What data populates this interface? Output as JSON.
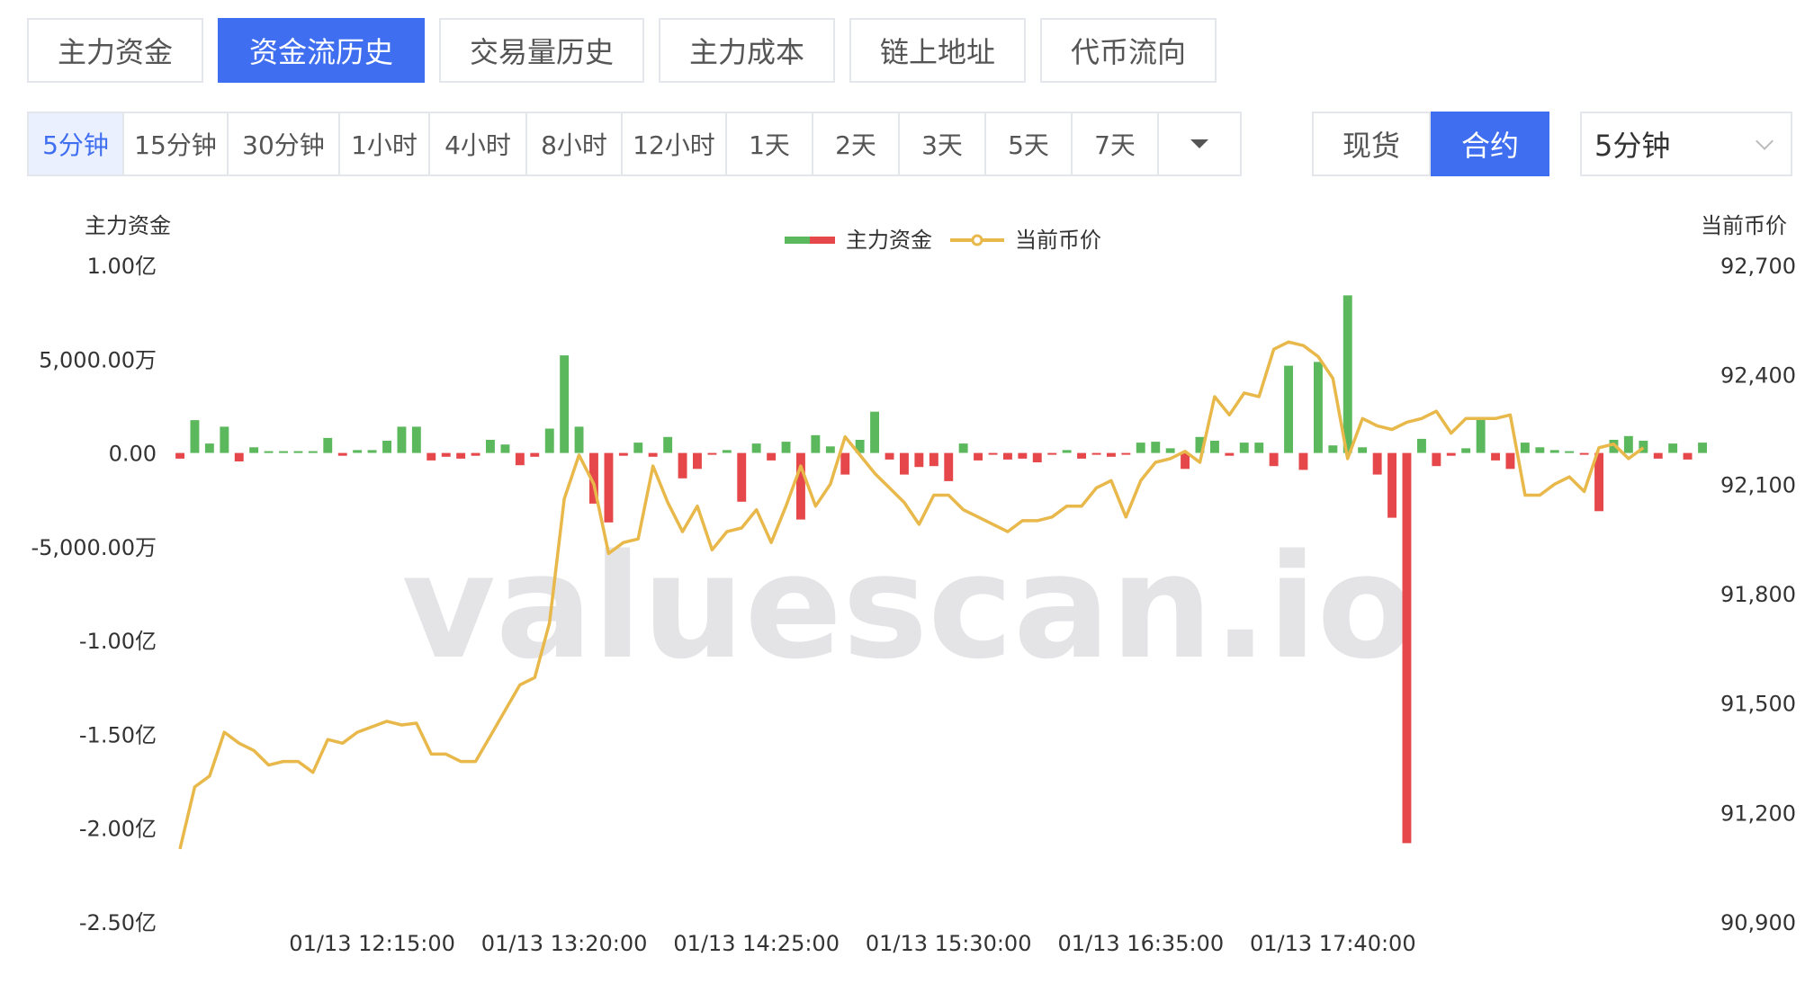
{
  "tabs": [
    {
      "label": "主力资金",
      "active": false
    },
    {
      "label": "资金流历史",
      "active": true
    },
    {
      "label": "交易量历史",
      "active": false
    },
    {
      "label": "主力成本",
      "active": false
    },
    {
      "label": "链上地址",
      "active": false
    },
    {
      "label": "代币流向",
      "active": false
    }
  ],
  "intervals": [
    {
      "label": "5分钟",
      "active": true
    },
    {
      "label": "15分钟",
      "active": false
    },
    {
      "label": "30分钟",
      "active": false
    },
    {
      "label": "1小时",
      "active": false
    },
    {
      "label": "4小时",
      "active": false
    },
    {
      "label": "8小时",
      "active": false
    },
    {
      "label": "12小时",
      "active": false
    },
    {
      "label": "1天",
      "active": false
    },
    {
      "label": "2天",
      "active": false
    },
    {
      "label": "3天",
      "active": false
    },
    {
      "label": "5天",
      "active": false
    },
    {
      "label": "7天",
      "active": false
    }
  ],
  "market": {
    "spot_label": "现货",
    "futures_label": "合约",
    "active": "futures"
  },
  "select": {
    "value": "5分钟"
  },
  "watermark": "valuescan.io",
  "colors": {
    "accent": "#3f6ef0",
    "inflow": "#5cb85c",
    "outflow": "#e5474b",
    "price_line": "#e8b84a"
  },
  "chart_data": {
    "type": "bar",
    "left_axis_title": "主力资金",
    "right_axis_title": "当前币价",
    "legend": [
      {
        "name": "主力资金",
        "type": "bar"
      },
      {
        "name": "当前币价",
        "type": "line"
      }
    ],
    "legend_position": "top-center",
    "y_left_ticks": [
      "1.00亿",
      "5,000.00万",
      "0.00",
      "-5,000.00万",
      "-1.00亿",
      "-1.50亿",
      "-2.00亿",
      "-2.50亿"
    ],
    "y_left_range": [
      -250000000,
      100000000
    ],
    "y_right_ticks": [
      "92,700",
      "92,400",
      "92,100",
      "91,800",
      "91,500",
      "91,200",
      "90,900"
    ],
    "y_right_range": [
      90900,
      92700
    ],
    "x_tick_labels": [
      "01/13 12:15:00",
      "01/13 13:20:00",
      "01/13 14:25:00",
      "01/13 15:30:00",
      "01/13 16:35:00",
      "01/13 17:40:00"
    ],
    "x_tick_indices": [
      13,
      26,
      39,
      52,
      65,
      78
    ],
    "grid": false,
    "series": [
      {
        "name": "主力资金",
        "values": [
          -3000000,
          17500000,
          5000000,
          14000000,
          -4500000,
          3000000,
          500000,
          200000,
          200000,
          400000,
          8000000,
          -1500000,
          1500000,
          1500000,
          6500000,
          14000000,
          14000000,
          -4000000,
          -2000000,
          -3000000,
          -1500000,
          7000000,
          4500000,
          -6500000,
          -2000000,
          13000000,
          52000000,
          14000000,
          -27000000,
          -37000000,
          -1500000,
          5500000,
          -2000000,
          8500000,
          -13500000,
          -8500000,
          -500000,
          1500000,
          -26000000,
          5000000,
          -4000000,
          6000000,
          -35500000,
          9500000,
          3500000,
          -11500000,
          7000000,
          22000000,
          -3500000,
          -11500000,
          -7500000,
          -7000000,
          -15000000,
          5000000,
          -4000000,
          -500000,
          -3500000,
          -3000000,
          -5000000,
          -500000,
          1500000,
          -3000000,
          -500000,
          -2000000,
          -500000,
          5500000,
          6000000,
          2500000,
          -8500000,
          8500000,
          6500000,
          -1500000,
          5500000,
          5500000,
          -7000000,
          46500000,
          -9000000,
          48500000,
          4000000,
          84000000,
          3000000,
          -11500000,
          -34500000,
          -208000000,
          7500000,
          -7000000,
          -1500000,
          2500000,
          19000000,
          -4000000,
          -8500000,
          5500000,
          3000000,
          1500000,
          500000,
          -500000,
          -31000000,
          7000000,
          9000000,
          6500000,
          -3000000,
          5000000,
          -3500000,
          5500000
        ],
        "color_up": "#5cb85c",
        "color_down": "#e5474b"
      },
      {
        "name": "当前币价",
        "values": [
          91100,
          91270,
          91300,
          91420,
          91390,
          91370,
          91330,
          91340,
          91340,
          91310,
          91400,
          91390,
          91420,
          91435,
          91450,
          91440,
          91445,
          91360,
          91360,
          91340,
          91340,
          91410,
          91480,
          91550,
          91570,
          91720,
          92060,
          92180,
          92100,
          91910,
          91940,
          91950,
          92150,
          92050,
          91970,
          92040,
          91920,
          91970,
          91980,
          92030,
          91940,
          92040,
          92150,
          92040,
          92100,
          92230,
          92180,
          92130,
          92090,
          92050,
          91990,
          92070,
          92070,
          92030,
          92010,
          91990,
          91970,
          92000,
          92000,
          92010,
          92040,
          92040,
          92090,
          92110,
          92010,
          92110,
          92160,
          92170,
          92190,
          92160,
          92340,
          92290,
          92350,
          92340,
          92470,
          92490,
          92480,
          92450,
          92390,
          92170,
          92280,
          92260,
          92250,
          92270,
          92280,
          92300,
          92240,
          92280,
          92280,
          92280,
          92290,
          92070,
          92070,
          92100,
          92120,
          92080,
          92200,
          92210,
          92170,
          92200
        ],
        "color": "#e8b84a"
      }
    ]
  }
}
